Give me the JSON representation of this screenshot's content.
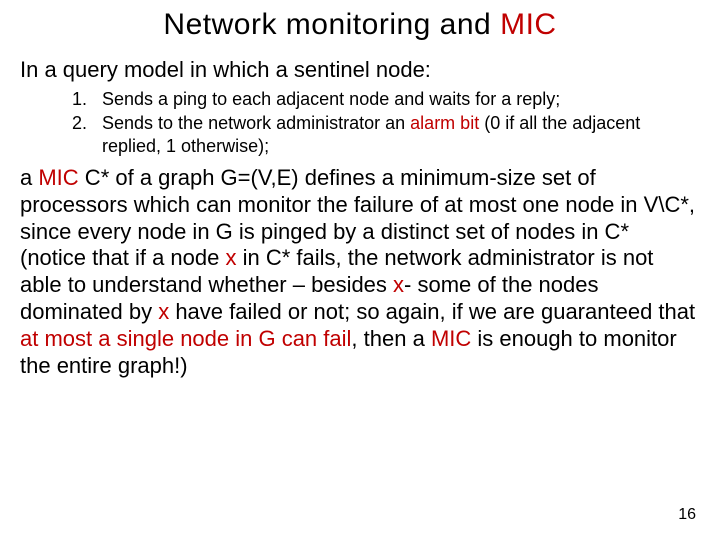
{
  "title": {
    "pre": "Network monitoring and ",
    "highlight": "MIC"
  },
  "intro": "In a query model in which a sentinel node:",
  "list": {
    "item1": "Sends a ping to each adjacent node and waits for a reply;",
    "item2_pre": "Sends to the network administrator an ",
    "item2_red": "alarm bit",
    "item2_post": " (0 if all the adjacent replied, 1 otherwise);"
  },
  "body": {
    "p1": "a ",
    "p2": "MIC",
    "p3": " C* of a graph G=(V,E) defines a minimum-size set of processors which can monitor the failure of at most one node in V\\C*, since every node in G is pinged by a distinct set of nodes in C* (notice that if a node ",
    "p4": "x",
    "p5": " in C* fails, the network administrator is not able to understand whether – besides ",
    "p6": "x",
    "p7": "- some of the nodes dominated by ",
    "p8": "x",
    "p9": " have failed or not; so again, if we are guaranteed that ",
    "p10": "at most a single node in G can fail",
    "p11": ", then a ",
    "p12": "MIC",
    "p13": " is enough to monitor the entire graph!)"
  },
  "page_number": "16"
}
